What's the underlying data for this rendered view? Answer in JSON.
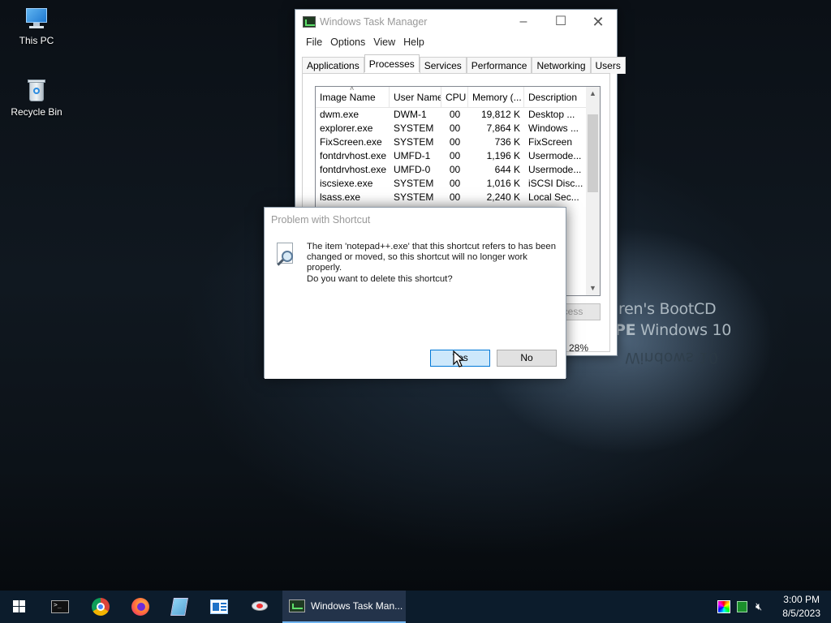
{
  "desktop": {
    "icons": [
      {
        "label": "This PC"
      },
      {
        "label": "Recycle Bin"
      }
    ],
    "wallpaper_text": {
      "line1": "iren's BootCD",
      "line2_bold": "PE",
      "line2_rest": " Windows 10",
      "reflection": "Windows 10"
    }
  },
  "task_manager": {
    "title": "Windows Task Manager",
    "menu": [
      "File",
      "Options",
      "View",
      "Help"
    ],
    "tabs": [
      "Applications",
      "Processes",
      "Services",
      "Performance",
      "Networking",
      "Users"
    ],
    "active_tab": "Processes",
    "columns": [
      "Image Name",
      "User Name",
      "CPU",
      "Memory (...",
      "Description"
    ],
    "rows": [
      {
        "image": "dwm.exe",
        "user": "DWM-1",
        "cpu": "00",
        "mem": "19,812 K",
        "desc": "Desktop ..."
      },
      {
        "image": "explorer.exe",
        "user": "SYSTEM",
        "cpu": "00",
        "mem": "7,864 K",
        "desc": "Windows ..."
      },
      {
        "image": "FixScreen.exe",
        "user": "SYSTEM",
        "cpu": "00",
        "mem": "736 K",
        "desc": "FixScreen"
      },
      {
        "image": "fontdrvhost.exe",
        "user": "UMFD-1",
        "cpu": "00",
        "mem": "1,196 K",
        "desc": "Usermode..."
      },
      {
        "image": "fontdrvhost.exe",
        "user": "UMFD-0",
        "cpu": "00",
        "mem": "644 K",
        "desc": "Usermode..."
      },
      {
        "image": "iscsiexe.exe",
        "user": "SYSTEM",
        "cpu": "00",
        "mem": "1,016 K",
        "desc": "iSCSI Disc..."
      },
      {
        "image": "lsass.exe",
        "user": "SYSTEM",
        "cpu": "00",
        "mem": "2,240 K",
        "desc": "Local Sec..."
      }
    ],
    "end_process_label": "cess",
    "cpu_usage_label": "28%"
  },
  "dialog": {
    "title": "Problem with Shortcut",
    "message": "The item 'notepad++.exe' that this shortcut refers to has been changed or moved, so this shortcut will no longer work properly.",
    "question": "Do you want to delete this shortcut?",
    "yes_label": "Yes",
    "no_label": "No"
  },
  "taskbar": {
    "pinned": [
      "command-prompt-icon",
      "chrome-icon",
      "firefox-icon",
      "notepad-icon",
      "explorer-icon",
      "network-tool-icon"
    ],
    "active_task_label": "Windows Task Man...",
    "clock_time": "3:00 PM",
    "clock_date": "8/5/2023"
  }
}
